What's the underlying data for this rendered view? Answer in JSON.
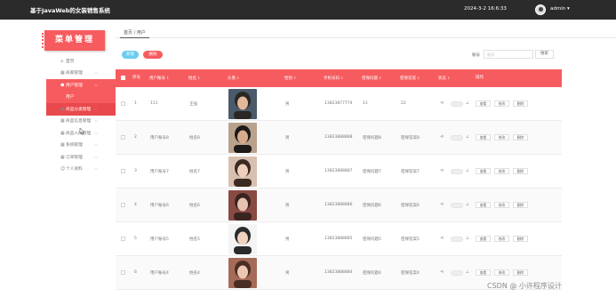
{
  "app": {
    "title": "基于JavaWeb的女装销售系统",
    "datetime": "2024-3-2 16:6:33",
    "user": "admin ▾"
  },
  "sidebar": {
    "logo_text": "菜单管理",
    "items": [
      {
        "label": "首页",
        "icon": "home-icon",
        "glyph": "⌂",
        "chevron": ""
      },
      {
        "label": "商家管理",
        "icon": "grid-icon",
        "glyph": "▦",
        "chevron": "⌵"
      },
      {
        "label": "用户管理",
        "icon": "user-group-icon",
        "glyph": "☗",
        "chevron": "⌵",
        "active": true
      },
      {
        "label": "用户",
        "icon": "",
        "glyph": "",
        "chevron": "",
        "sub": true
      },
      {
        "label": "商品分类管理",
        "icon": "grid-icon",
        "glyph": "▦",
        "chevron": "⌵",
        "sub": true,
        "highlight": true
      },
      {
        "label": "商品信息管理",
        "icon": "grid-icon",
        "glyph": "▦",
        "chevron": "⌵"
      },
      {
        "label": "商品入库管理",
        "icon": "grid-icon",
        "glyph": "▦",
        "chevron": "⌵"
      },
      {
        "label": "系统管理",
        "icon": "grid-icon",
        "glyph": "▦",
        "chevron": "⌵"
      },
      {
        "label": "订单管理",
        "icon": "grid-icon",
        "glyph": "▦",
        "chevron": "⌵"
      },
      {
        "label": "个人资料",
        "icon": "user-icon",
        "glyph": "☺",
        "chevron": "⌵"
      }
    ]
  },
  "breadcrumb": "首页 / 用户",
  "toolbar": {
    "add_label": "新增",
    "delete_label": "删除",
    "search_label": "账号",
    "search_placeholder": "账号",
    "search_button": "搜索"
  },
  "table": {
    "headers": [
      "序号",
      "用户账号",
      "姓名",
      "头像",
      "性别",
      "手机号码",
      "密保问题",
      "密保答案",
      "状态",
      "操作"
    ],
    "sort_glyph": "↕",
    "action_labels": [
      "查看",
      "修改",
      "删除"
    ],
    "share_glyph": "⋖",
    "edit_glyph": "∠",
    "rows": [
      {
        "index": "1",
        "account": "111",
        "name": "王强",
        "gender": "男",
        "phone": "13823877774",
        "question": "11",
        "answer": "22",
        "photo": "person-1"
      },
      {
        "index": "2",
        "account": "用户账号8",
        "name": "姓名8",
        "gender": "男",
        "phone": "13823888888",
        "question": "密保问题8",
        "answer": "密保答案8",
        "photo": "person-2"
      },
      {
        "index": "3",
        "account": "用户账号7",
        "name": "姓名7",
        "gender": "男",
        "phone": "13823888887",
        "question": "密保问题7",
        "answer": "密保答案7",
        "photo": "person-3"
      },
      {
        "index": "4",
        "account": "用户账号6",
        "name": "姓名6",
        "gender": "男",
        "phone": "13823888886",
        "question": "密保问题6",
        "answer": "密保答案6",
        "photo": "person-4"
      },
      {
        "index": "5",
        "account": "用户账号5",
        "name": "姓名5",
        "gender": "男",
        "phone": "13823888885",
        "question": "密保问题5",
        "answer": "密保答案5",
        "photo": "person-5"
      },
      {
        "index": "6",
        "account": "用户账号4",
        "name": "姓名4",
        "gender": "男",
        "phone": "13823888884",
        "question": "密保问题4",
        "answer": "密保答案4",
        "photo": "person-6"
      }
    ]
  },
  "watermark": "CSDN @ 小许程序设计",
  "colors": {
    "accent": "#f65c5f",
    "topbar": "#2b2b2b",
    "add_button": "#6ccbf0"
  }
}
